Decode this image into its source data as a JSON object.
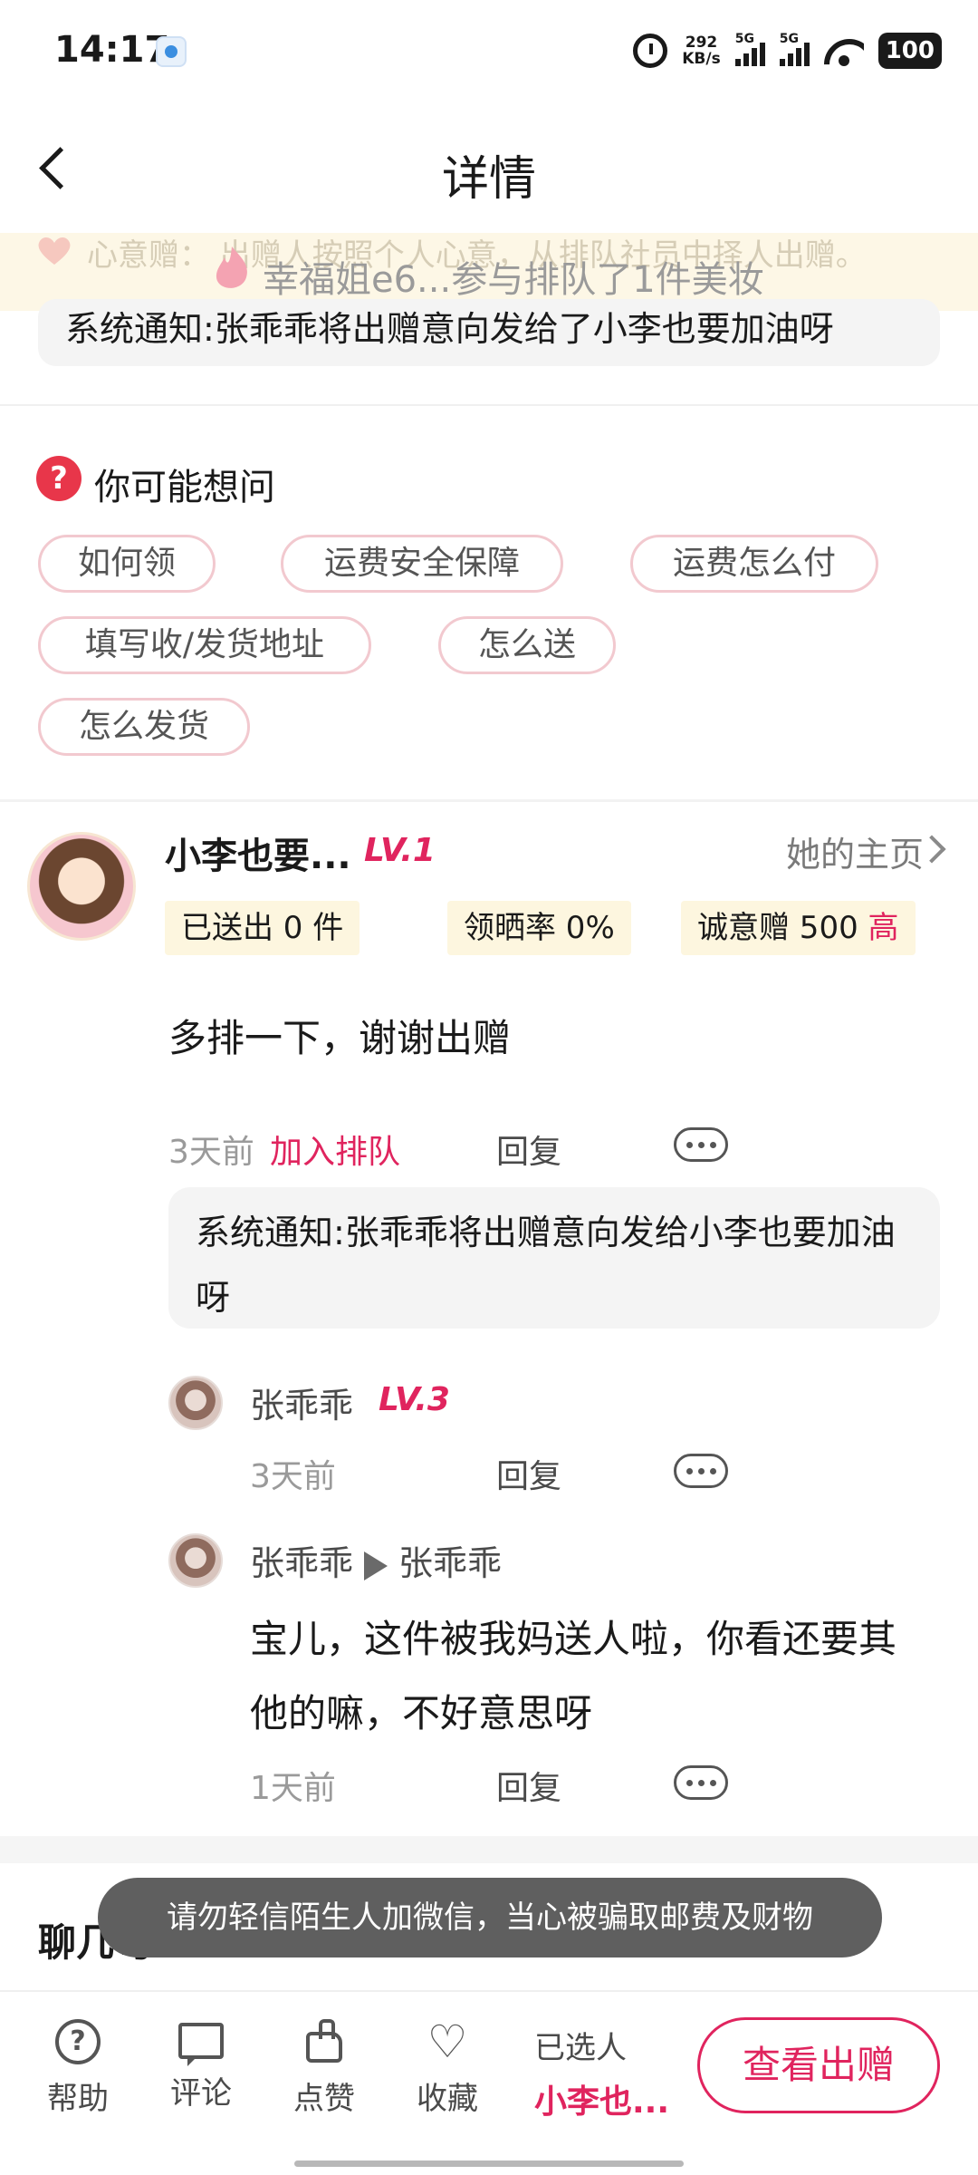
{
  "status": {
    "time": "14:17",
    "net_speed_value": "292",
    "net_speed_unit": "KB/s",
    "sig1": "5G",
    "sig2": "5G",
    "battery": "100"
  },
  "header": {
    "title": "详情"
  },
  "banner": {
    "faded_text": "心意赠：  出赠人按照个人心意，从排队社员中择人出赠。",
    "ticker_text": "幸福姐e6...参与排队了1件美妆",
    "system_notice": "系统通知:张乖乖将出赠意向发给了小李也要加油呀"
  },
  "faq": {
    "title": "你可能想问",
    "icon_text": "?",
    "chips": [
      "如何领",
      "运费安全保障",
      "运费怎么付",
      "填写收/发货地址",
      "怎么送",
      "怎么发货"
    ]
  },
  "user": {
    "name": "小李也要...",
    "level": "LV.1",
    "homepage": "她的主页",
    "stat_sent": "已送出 0 件",
    "stat_rate": "领晒率 0%",
    "stat_sincere_label": "诚意赠 500 ",
    "stat_sincere_high": "高"
  },
  "comment": {
    "text": "多排一下，谢谢出赠",
    "time": "3天前",
    "action": "加入排队",
    "reply": "回复",
    "system_notice": "系统通知:张乖乖将出赠意向发给小李也要加油呀"
  },
  "replies": [
    {
      "name": "张乖乖",
      "level": "LV.3",
      "time": "3天前",
      "reply": "回复"
    },
    {
      "name": "张乖乖",
      "to": "张乖乖",
      "body": "宝儿，这件被我妈送人啦，你看还要其他的嘛，不好意思呀",
      "time": "1天前",
      "reply": "回复"
    }
  ],
  "chat": {
    "title": "聊几句"
  },
  "toast": "请勿轻信陌生人加微信，当心被骗取邮费及财物",
  "bottom_bar": {
    "help": "帮助",
    "comment": "评论",
    "like": "点赞",
    "favorite": "收藏",
    "favorite_icon": "♡",
    "help_icon": "?",
    "selected_label": "已选人",
    "selected_name": "小李也...",
    "view_button": "查看出赠"
  },
  "colors": {
    "accent": "#e0245e",
    "banner_bg": "#fdf7e6",
    "stat_bg": "#fdf6df",
    "chip_border": "#f2c9cf"
  }
}
